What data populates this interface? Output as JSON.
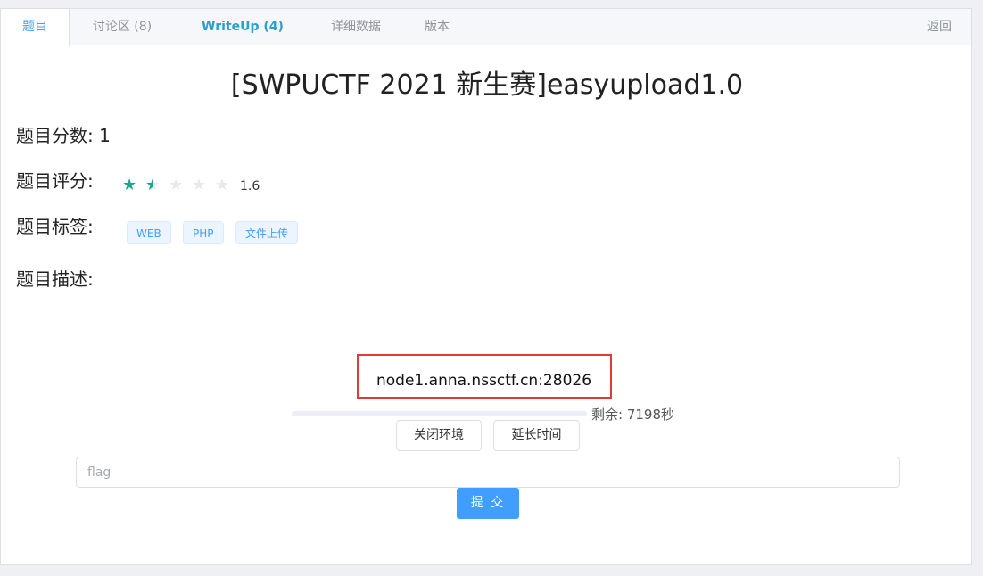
{
  "tabs": [
    {
      "label": "题目"
    },
    {
      "label": "讨论区 (8)"
    },
    {
      "label": "WriteUp (4)"
    },
    {
      "label": "详细数据"
    },
    {
      "label": "版本"
    }
  ],
  "back_label": "返回",
  "problem": {
    "title": "[SWPUCTF 2021 新生赛]easyupload1.0",
    "score_label": "题目分数:",
    "score_value": "1",
    "rating_label": "题目评分:",
    "rating_value": "1.6",
    "rating_stars": 1.5,
    "rating_max": 5,
    "tags_label": "题目标签:",
    "tags": [
      "WEB",
      "PHP",
      "文件上传"
    ],
    "desc_label": "题目描述:"
  },
  "environment": {
    "address": "node1.anna.nssctf.cn:28026",
    "remaining_text": "剩余: 7198秒",
    "close_button": "关闭环境",
    "extend_button": "延长时间"
  },
  "flag": {
    "placeholder": "flag",
    "value": "",
    "submit_label": "提 交"
  },
  "colors": {
    "accent": "#409eff",
    "star": "#17a78e",
    "highlight_box": "#e03b3b"
  }
}
